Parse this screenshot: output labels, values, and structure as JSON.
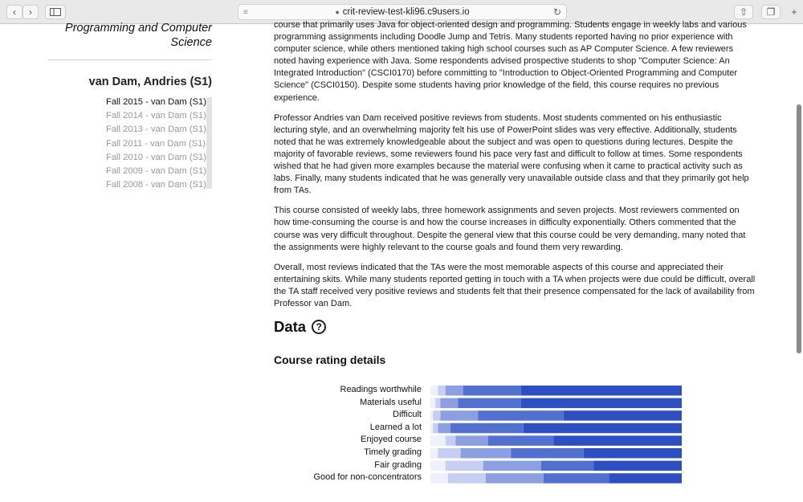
{
  "browser": {
    "address": "crit-review-test-kli96.c9users.io",
    "back_icon": "chevron-left",
    "forward_icon": "chevron-right",
    "sidebar_icon": "sidebar",
    "reader_icon": "lines",
    "reload_icon": "reload",
    "share_icon": "share",
    "tabs_icon": "tabs",
    "newtab_label": "+"
  },
  "sidebar": {
    "dept_line1": "Programming and Computer",
    "dept_line2": "Science",
    "professor": "van Dam, Andries (S1)",
    "semesters": [
      "Fall 2015 - van Dam (S1)",
      "Fall 2014 - van Dam (S1)",
      "Fall 2013 - van Dam (S1)",
      "Fall 2011 - van Dam (S1)",
      "Fall 2010 - van Dam (S1)",
      "Fall 2009 - van Dam (S1)",
      "Fall 2008 - van Dam (S1)"
    ]
  },
  "main": {
    "paragraphs": [
      "course that primarily uses Java for object-oriented design and programming. Students engage in weekly labs and various programming assignments including Doodle Jump and Tetris. Many students reported having no prior experience with computer science, while others mentioned taking high school courses such as AP Computer Science. A few reviewers noted having experience with Java. Some respondents advised prospective students to shop \"Computer Science: An Integrated Introduction\" (CSCI0170) before committing to \"Introduction to Object-Oriented Programming and Computer Science\" (CSCI0150). Despite some students having prior knowledge of the field, this course requires no previous experience.",
      "Professor Andries van Dam received positive reviews from students. Most students commented on his enthusiastic lecturing style, and an overwhelming majority felt his use of PowerPoint slides was very effective. Additionally, students noted that he was extremely knowledgeable about the subject and was open to questions during lectures. Despite the majority of favorable reviews, some reviewers found his pace very fast and difficult to follow at times. Some respondents wished that he had given more examples because the material were confusing when it came to practical activity such as labs. Finally, many students indicated that he was generally very unavailable outside class and that they primarily got help from TAs.",
      "This course consisted of weekly labs, three homework assignments and seven projects. Most reviewers commented on how time-consuming the course is and how the course increases in difficulty exponentially. Others commented that the course was very difficult throughout. Despite the general view that this course could be very demanding, many noted that the assignments were highly relevant to the course goals and found them very rewarding.",
      "Overall, most reviews indicated that the TAs were the most memorable aspects of this course and appreciated their entertaining skits. While many students reported getting in touch with a TA when projects were due could be difficult, overall the TA staff received very positive reviews and students felt that their presence compensated for the lack of availability from Professor van Dam."
    ],
    "data_heading": "Data",
    "help_label": "?",
    "rating_heading": "Course rating details"
  },
  "chart_data": {
    "type": "bar",
    "stacked": true,
    "orientation": "horizontal",
    "categories": [
      "Readings worthwhile",
      "Materials useful",
      "Difficult",
      "Learned a lot",
      "Enjoyed course",
      "Timely grading",
      "Fair grading",
      "Good for non-concentrators"
    ],
    "series": [
      {
        "values": [
          3,
          2,
          1,
          1,
          6,
          3,
          6,
          7
        ]
      },
      {
        "values": [
          3,
          2,
          3,
          2,
          4,
          9,
          15,
          15
        ]
      },
      {
        "values": [
          7,
          7,
          15,
          5,
          13,
          20,
          23,
          23
        ]
      },
      {
        "values": [
          23,
          25,
          34,
          29,
          26,
          29,
          21,
          26
        ]
      },
      {
        "values": [
          64,
          64,
          47,
          63,
          51,
          39,
          35,
          29
        ]
      }
    ],
    "colors": [
      "#eef0fb",
      "#c6cff1",
      "#8c9fe0",
      "#5270d0",
      "#2d4fc2"
    ],
    "xlim": [
      0,
      100
    ]
  }
}
